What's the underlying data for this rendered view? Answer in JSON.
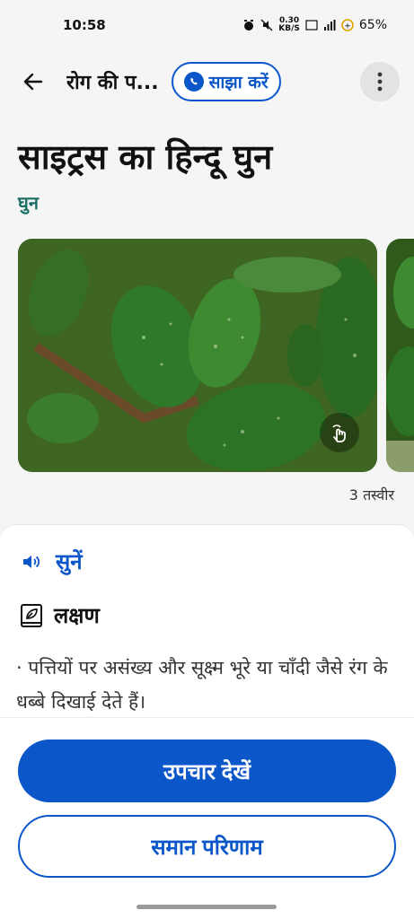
{
  "status_bar": {
    "time": "10:58",
    "speed_value": "0.30",
    "speed_unit": "KB/S",
    "battery": "65%",
    "icons": [
      "alarm-icon",
      "mute-icon",
      "volte-icon",
      "signal-icon",
      "battery-icon"
    ]
  },
  "app_bar": {
    "title": "रोग की प...",
    "share_label": "साझा करें",
    "back_icon": "arrow-left-icon",
    "more_icon": "more-vertical-icon"
  },
  "page": {
    "title": "साइट्रस का हिन्दू घुन",
    "category": "घुन"
  },
  "gallery": {
    "photo_count_label": "3 तस्वीर"
  },
  "details": {
    "listen_label": "सुनें",
    "symptoms_heading": "लक्षण",
    "symptom_text": "· पत्तियों पर असंख्य और सूक्ष्म भूरे या चाँदी जैसे रंग के धब्बे दिखाई देते हैं।"
  },
  "actions": {
    "primary_label": "उपचार देखें",
    "secondary_label": "समान परिणाम"
  },
  "colors": {
    "accent": "#0b56c8",
    "category": "#1b6e63",
    "background": "#f5f5f5"
  }
}
